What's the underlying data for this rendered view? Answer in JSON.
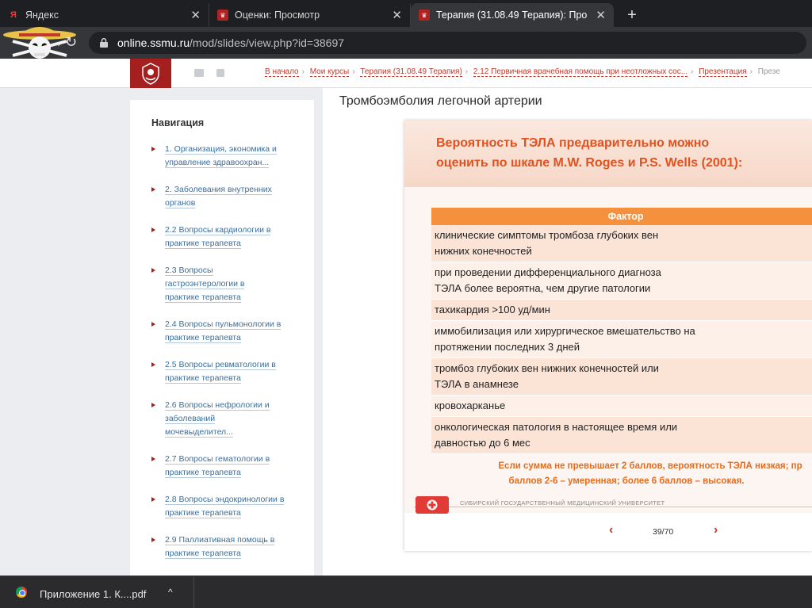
{
  "browser": {
    "tabs": [
      {
        "title": "Яндекс",
        "icon": "yandex-icon",
        "active": false
      },
      {
        "title": "Оценки: Просмотр",
        "icon": "crest-icon",
        "active": false
      },
      {
        "title": "Терапия (31.08.49 Терапия): Про",
        "icon": "crest-icon",
        "active": true
      }
    ],
    "url_host": "online.ssmu.ru",
    "url_path": "/mod/slides/view.php?id=38697"
  },
  "site": {
    "breadcrumb": [
      "В начало",
      "Мои курсы",
      "Терапия (31.08.49 Терапия)",
      "2.12 Первичная врачебная помощь при неотложных сос...",
      "Презентация",
      "Презе"
    ]
  },
  "navigation": {
    "title": "Навигация",
    "items": [
      "1. Организация, экономика и управление здравоохран...",
      "2. Заболевания внутренних органов",
      "2.2 Вопросы кардиологии в практике терапевта",
      "2.3 Вопросы гастроэнтерологии в практике терапевта",
      "2.4 Вопросы пульмонологии в практике терапевта",
      "2.5 Вопросы ревматологии в практике терапевта",
      "2.6 Вопросы нефрологии и заболеваний мочевыделител...",
      "2.7 Вопросы гематологии в практике терапевта",
      "2.8 Вопросы эндокринологии в практике терапевта",
      "2.9 Паллиативная помощь в практике терапевта"
    ]
  },
  "content": {
    "title": "Тромбоэмболия легочной артерии",
    "slide": {
      "heading_line1": "Вероятность ТЭЛА предварительно можно",
      "heading_line2": "оценить по шкале M.W. Roges и P.S. Wells (2001):",
      "table_header": "Фактор",
      "factors": [
        [
          "клинические симптомы тромбоза глубоких вен",
          "нижних конечностей"
        ],
        [
          "при проведении дифференциального диагноза",
          "ТЭЛА более вероятна, чем другие патологии"
        ],
        [
          "тахикардия >100 уд/мин"
        ],
        [
          "иммобилизация или хирургическое вмешательство  на",
          "протяжении последних 3 дней"
        ],
        [
          "тромбоз глубоких вен нижних конечностей или",
          "ТЭЛА в анамнезе"
        ],
        [
          "кровохарканье"
        ],
        [
          "онкологическая патология в настоящее время или",
          "давностью до 6 мес"
        ]
      ],
      "note_line1": "Если сумма не превышает 2 баллов,  вероятность  ТЭЛА низкая;  пр",
      "note_line2": "баллов 2-6 – умеренная;  более 6 баллов – высокая.",
      "university": "СИБИРСКИЙ ГОСУДАРСТВЕННЫЙ МЕДИЦИНСКИЙ УНИВЕРСИТЕТ"
    },
    "pager": {
      "prev": "‹",
      "next": "›",
      "count": "39/70"
    }
  },
  "downloads": {
    "file": "Приложение 1. К....pdf",
    "caret": "^"
  },
  "colors": {
    "accent_red": "#a51f1f",
    "slide_orange": "#e2511e",
    "table_header": "#f5913e",
    "link_blue": "#3a6e9c"
  }
}
